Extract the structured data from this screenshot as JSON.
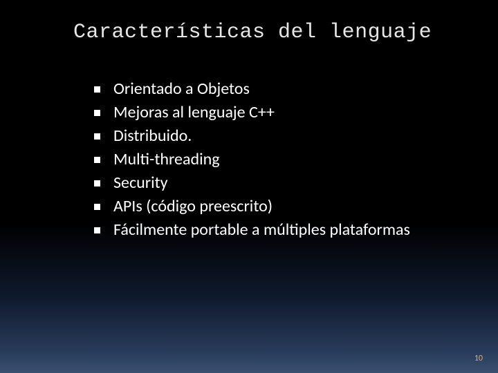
{
  "title": "Características del lenguaje",
  "bullets": [
    "Orientado a Objetos",
    "Mejoras al lenguaje C++",
    "Distribuido.",
    "Multi-threading",
    "Security",
    "APIs (código preescrito)",
    "Fácilmente portable a múltiples plataformas"
  ],
  "page_number": "10"
}
